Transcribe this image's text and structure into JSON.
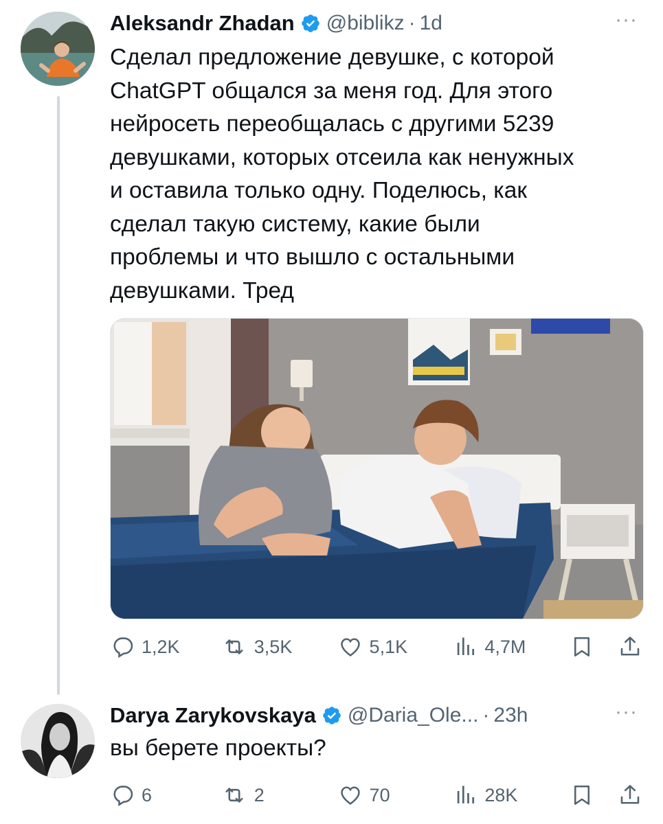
{
  "tweet": {
    "author_name": "Aleksandr Zhadan",
    "handle": "@biblikz",
    "separator": "·",
    "time": "1d",
    "more": "···",
    "text_lines": [
      "Сделал предложение девушке, с которой",
      "ChatGPT общался за меня год. Для этого",
      "нейросеть переобщалась с другими 5239",
      "девушками, которых отсеила как ненужных",
      "и оставила только одну. Поделюсь, как",
      "сделал такую систему, какие были",
      "проблемы и что вышло с остальными",
      "девушками. Тред"
    ],
    "stats": {
      "replies": "1,2K",
      "reposts": "3,5K",
      "likes": "5,1K",
      "views": "4,7M"
    }
  },
  "reply": {
    "author_name": "Darya Zarykovskaya",
    "handle": "@Daria_Ole...",
    "separator": "·",
    "time": "23h",
    "more": "···",
    "text": "вы берете проекты?",
    "stats": {
      "replies": "6",
      "reposts": "2",
      "likes": "70",
      "views": "28K"
    }
  },
  "colors": {
    "verified": "#1d9bf0",
    "text": "#0f1419",
    "secondary": "#536471",
    "thread_line": "#cfd9de"
  },
  "icons": [
    "reply-icon",
    "repost-icon",
    "like-icon",
    "views-icon",
    "bookmark-icon",
    "share-icon",
    "verified-badge-icon"
  ]
}
